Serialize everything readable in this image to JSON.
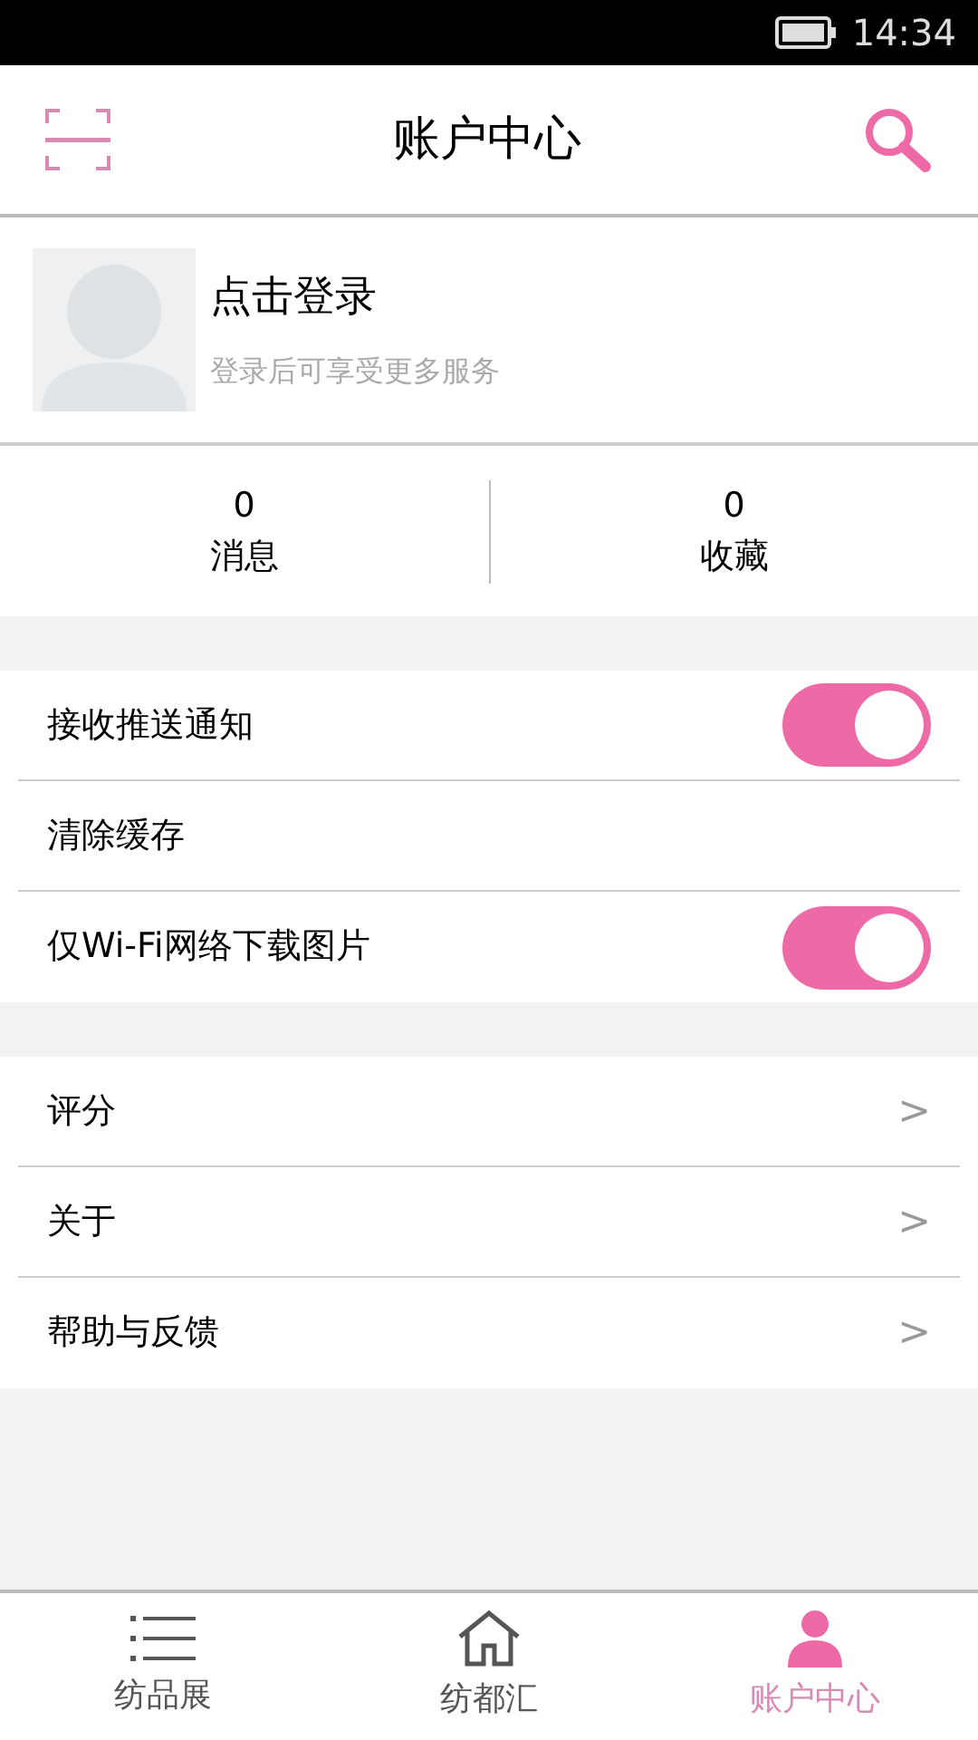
{
  "status_bar": {
    "time": "14:34"
  },
  "header": {
    "title": "账户中心"
  },
  "profile": {
    "name": "点击登录",
    "subtitle": "登录后可享受更多服务"
  },
  "stats": [
    {
      "count": "0",
      "label": "消息"
    },
    {
      "count": "0",
      "label": "收藏"
    }
  ],
  "settings": [
    {
      "kind": "toggle",
      "label": "接收推送通知",
      "on": true
    },
    {
      "kind": "plain",
      "label": "清除缓存"
    },
    {
      "kind": "toggle",
      "label": "仅Wi-Fi网络下载图片",
      "on": true
    }
  ],
  "menu": [
    {
      "label": "评分",
      "arrow": ">"
    },
    {
      "label": "关于",
      "arrow": ">"
    },
    {
      "label": "帮助与反馈",
      "arrow": ">"
    }
  ],
  "tabs": [
    {
      "label": "纺品展",
      "kind": "list",
      "selected": false
    },
    {
      "label": "纺都汇",
      "kind": "home",
      "selected": false
    },
    {
      "label": "账户中心",
      "kind": "person",
      "selected": true
    }
  ]
}
